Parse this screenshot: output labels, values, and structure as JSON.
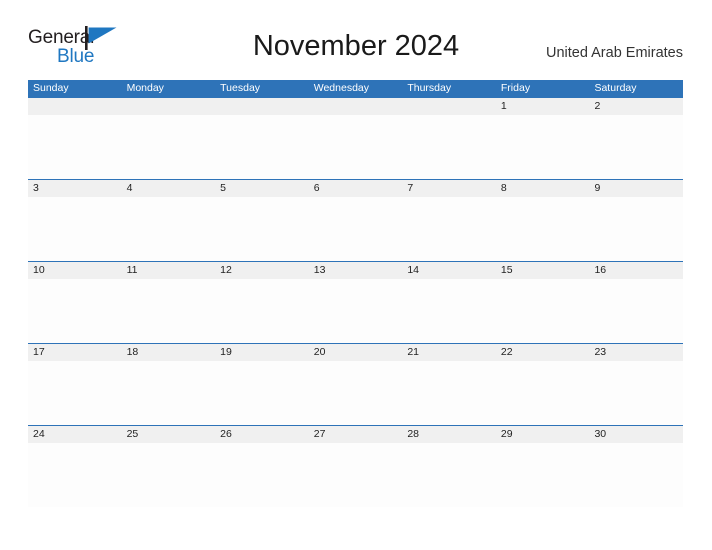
{
  "brand": {
    "name_part1": "General",
    "name_part2": "Blue",
    "flag_color": "#1f77c1"
  },
  "header": {
    "title": "November 2024",
    "country": "United Arab Emirates"
  },
  "colors": {
    "header_blue": "#2e73b8",
    "date_band_gray": "#f0f0f0",
    "text_dark": "#222222"
  },
  "calendar": {
    "weekday_headers": [
      "Sunday",
      "Monday",
      "Tuesday",
      "Wednesday",
      "Thursday",
      "Friday",
      "Saturday"
    ],
    "weeks": [
      [
        "",
        "",
        "",
        "",
        "",
        "1",
        "2"
      ],
      [
        "3",
        "4",
        "5",
        "6",
        "7",
        "8",
        "9"
      ],
      [
        "10",
        "11",
        "12",
        "13",
        "14",
        "15",
        "16"
      ],
      [
        "17",
        "18",
        "19",
        "20",
        "21",
        "22",
        "23"
      ],
      [
        "24",
        "25",
        "26",
        "27",
        "28",
        "29",
        "30"
      ]
    ]
  }
}
